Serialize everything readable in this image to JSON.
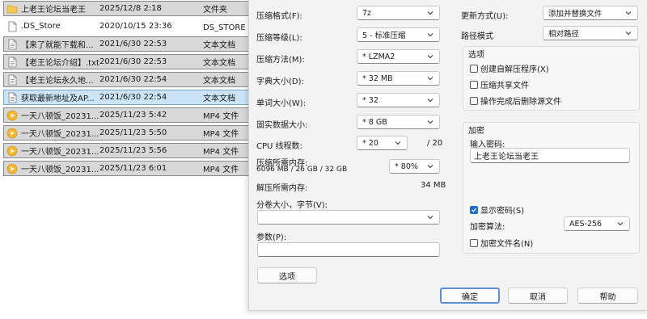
{
  "files": [
    {
      "name": "上老王论坛当老王",
      "date": "2025/12/8 2:18",
      "type": "文件夹",
      "icon": "folder-icon",
      "style": "gray"
    },
    {
      "name": ".DS_Store",
      "date": "2020/10/15 23:36",
      "type": "DS_STORE 文",
      "icon": "file-icon",
      "style": "plain"
    },
    {
      "name": "【来了就能下载和...",
      "date": "2021/6/30 22:53",
      "type": "文本文档",
      "icon": "text-file-icon",
      "style": "gray"
    },
    {
      "name": "【老王论坛介绍】.txt",
      "date": "2021/6/30 22:53",
      "type": "文本文档",
      "icon": "text-file-icon",
      "style": "gray"
    },
    {
      "name": "【老王论坛永久地...",
      "date": "2021/6/30 22:54",
      "type": "文本文档",
      "icon": "text-file-icon",
      "style": "gray"
    },
    {
      "name": "获取最新地址及AP...",
      "date": "2021/6/30 22:54",
      "type": "文本文档",
      "icon": "text-file-icon",
      "style": "sel"
    },
    {
      "name": "一天八顿饭_20231...",
      "date": "2025/11/23 5:42",
      "type": "MP4 文件",
      "icon": "video-file-icon",
      "style": "gray"
    },
    {
      "name": "一天八顿饭_20231...",
      "date": "2025/11/23 5:50",
      "type": "MP4 文件",
      "icon": "video-file-icon",
      "style": "gray"
    },
    {
      "name": "一天八顿饭_20231...",
      "date": "2025/11/23 5:56",
      "type": "MP4 文件",
      "icon": "video-file-icon",
      "style": "gray"
    },
    {
      "name": "一天八顿饭_20231...",
      "date": "2025/11/23 6:01",
      "type": "MP4 文件",
      "icon": "video-file-icon",
      "style": "gray"
    }
  ],
  "dialog": {
    "left": {
      "format_label": "压缩格式(F):",
      "format_value": "7z",
      "level_label": "压缩等级(L):",
      "level_value": "5 - 标准压缩",
      "method_label": "压缩方法(M):",
      "method_value": "* LZMA2",
      "dict_label": "字典大小(D):",
      "dict_value": "* 32 MB",
      "word_label": "单词大小(W):",
      "word_value": "* 32",
      "solid_label": "固实数据大小:",
      "solid_value": "* 8 GB",
      "cpu_label": "CPU 线程数:",
      "cpu_value": "* 20",
      "cpu_max": "/ 20",
      "mem_comp_label": "压缩所需内存:",
      "mem_comp_detail": "6096 MB / 26 GB / 32 GB",
      "mem_pct_value": "* 80%",
      "mem_decomp_label": "解压所需内存:",
      "mem_decomp_value": "34 MB",
      "split_label": "分卷大小，字节(V):",
      "split_value": "",
      "params_label": "参数(P):",
      "params_value": "",
      "options_button": "选项"
    },
    "right": {
      "update_label": "更新方式(U):",
      "update_value": "添加并替换文件",
      "path_label": "路径模式",
      "path_value": "相对路径",
      "options_group": "选项",
      "opt_sfx": "创建自解压程序(X)",
      "opt_shared": "压缩共享文件",
      "opt_delete": "操作完成后删除源文件",
      "encrypt_group": "加密",
      "password_label": "输入密码:",
      "password_value": "上老王论坛当老王",
      "show_password": "显示密码(S)",
      "algo_label": "加密算法:",
      "algo_value": "AES-256",
      "encrypt_names": "加密文件名(N)"
    },
    "buttons": {
      "ok": "确定",
      "cancel": "取消",
      "help": "帮助"
    }
  },
  "colors": {
    "accent": "#1f6fd0",
    "selected_row": "#cce4f7",
    "folder": "#f2c94c",
    "video": "#f5b82e"
  }
}
